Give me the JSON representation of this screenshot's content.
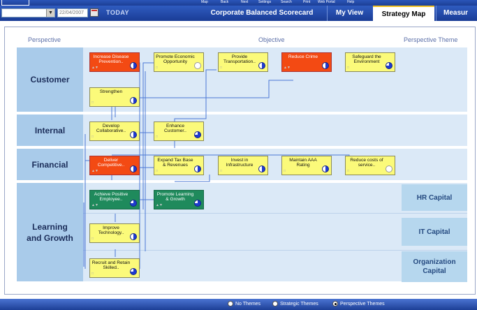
{
  "toolbar": {
    "items": [
      "Map",
      "Back",
      "Next",
      "Settings",
      "Search",
      "Print",
      "Web Portal",
      "Help"
    ]
  },
  "header": {
    "date_value": "22/04/2007",
    "today_label": "TODAY"
  },
  "tabs": [
    {
      "label": "Corporate Balanced Scorecard",
      "active": false
    },
    {
      "label": "My View",
      "active": false
    },
    {
      "label": "Strategy Map",
      "active": true
    },
    {
      "label": "Measur",
      "active": false
    }
  ],
  "columns": {
    "perspective": "Perspective",
    "objective": "Objective",
    "theme": "Perspective Theme"
  },
  "perspectives": [
    {
      "label": "Customer"
    },
    {
      "label": "Internal"
    },
    {
      "label": "Financial"
    },
    {
      "label": "Learning and Growth"
    }
  ],
  "themes": [
    "HR Capital",
    "IT Capital",
    "Organization Capital"
  ],
  "objectives": [
    {
      "label": "Increase Disease Prevention..",
      "color": "red",
      "pie": "half"
    },
    {
      "label": "Promote Economic Opportunity",
      "color": "yellow",
      "pie": "empty"
    },
    {
      "label": "Provide Transportation..",
      "color": "yellow",
      "pie": "half"
    },
    {
      "label": "Reduce Crime",
      "color": "red",
      "pie": "half"
    },
    {
      "label": "Safeguard the Environment",
      "color": "yellow",
      "pie": "full"
    },
    {
      "label": "Strengthen",
      "color": "yellow",
      "pie": "half"
    },
    {
      "label": "Develop Collaborative..",
      "color": "yellow",
      "pie": "half"
    },
    {
      "label": "Enhance Customer..",
      "color": "yellow",
      "pie": "full"
    },
    {
      "label": "Deliver Competitive..",
      "color": "red",
      "pie": "half"
    },
    {
      "label": "Expand Tax Base & Revenues",
      "color": "yellow",
      "pie": "half"
    },
    {
      "label": "Invest in Infrastructure",
      "color": "yellow",
      "pie": "half"
    },
    {
      "label": "Maintain AAA Rating",
      "color": "yellow",
      "pie": "half"
    },
    {
      "label": "Reduce costs of service..",
      "color": "yellow",
      "pie": "empty"
    },
    {
      "label": "Achieve Positive Employee..",
      "color": "green",
      "pie": "full"
    },
    {
      "label": "Promote Learning & Growth",
      "color": "green",
      "pie": "full"
    },
    {
      "label": "Improve Technology..",
      "color": "yellow",
      "pie": "half"
    },
    {
      "label": "Recruit and Retain Skilled..",
      "color": "yellow",
      "pie": "full"
    }
  ],
  "footer": {
    "options": [
      "No Themes",
      "Strategic Themes",
      "Perspective Themes"
    ],
    "selected": "Perspective Themes"
  },
  "colors": {
    "header": "#1a3c95",
    "band": "#dbe9f7",
    "bandLabel": "#a9cbea",
    "red": "#f34a13",
    "yellow": "#fbfa7a",
    "green": "#1f8a5c",
    "connector": "#4b78d6"
  }
}
